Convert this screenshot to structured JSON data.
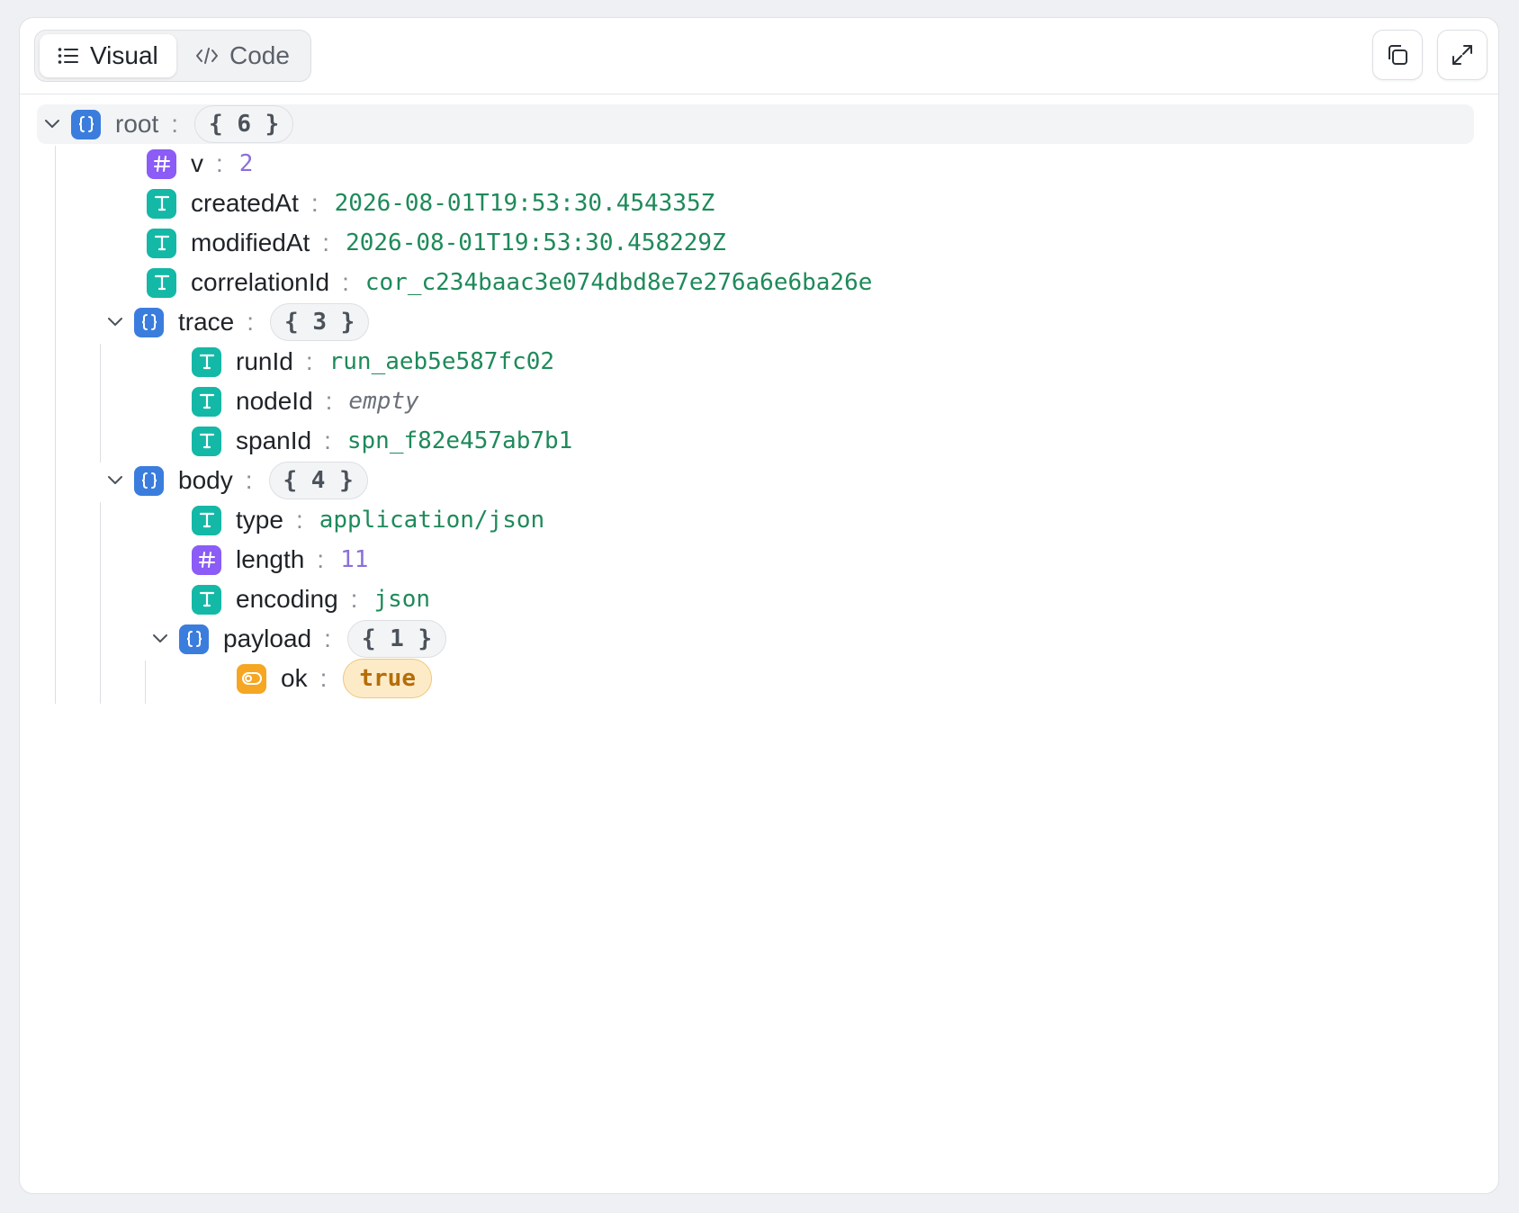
{
  "toolbar": {
    "tabs": [
      {
        "label": "Visual",
        "icon": "list-icon",
        "active": true
      },
      {
        "label": "Code",
        "icon": "code-icon",
        "active": false
      }
    ],
    "actions": [
      {
        "name": "copy",
        "icon": "copy-icon"
      },
      {
        "name": "expand",
        "icon": "expand-icon"
      }
    ]
  },
  "tree": {
    "root": {
      "key": "root",
      "count": "{ 6 }"
    },
    "v": {
      "key": "v",
      "value": "2",
      "type": "number"
    },
    "createdAt": {
      "key": "createdAt",
      "value": "2026-08-01T19:53:30.454335Z",
      "type": "string"
    },
    "modifiedAt": {
      "key": "modifiedAt",
      "value": "2026-08-01T19:53:30.458229Z",
      "type": "string"
    },
    "correlationId": {
      "key": "correlationId",
      "value": "cor_c234baac3e074dbd8e7e276a6e6ba26e",
      "type": "string"
    },
    "trace": {
      "key": "trace",
      "count": "{ 3 }",
      "runId": {
        "key": "runId",
        "value": "run_aeb5e587fc02",
        "type": "string"
      },
      "nodeId": {
        "key": "nodeId",
        "value": "empty",
        "type": "string"
      },
      "spanId": {
        "key": "spanId",
        "value": "spn_f82e457ab7b1",
        "type": "string"
      }
    },
    "body": {
      "key": "body",
      "count": "{ 4 }",
      "type": {
        "key": "type",
        "value": "application/json",
        "type": "string"
      },
      "length": {
        "key": "length",
        "value": "11",
        "type": "number"
      },
      "encoding": {
        "key": "encoding",
        "value": "json",
        "type": "string"
      },
      "payload": {
        "key": "payload",
        "count": "{ 1 }",
        "ok": {
          "key": "ok",
          "value": "true",
          "type": "boolean"
        }
      }
    }
  },
  "colors": {
    "object_icon": "#3b7ddd",
    "number_icon": "#8b5cf6",
    "string_icon": "#14b8a6",
    "boolean_icon": "#f5a623",
    "string_value": "#1e8a5a",
    "number_value": "#8b6fd9"
  }
}
